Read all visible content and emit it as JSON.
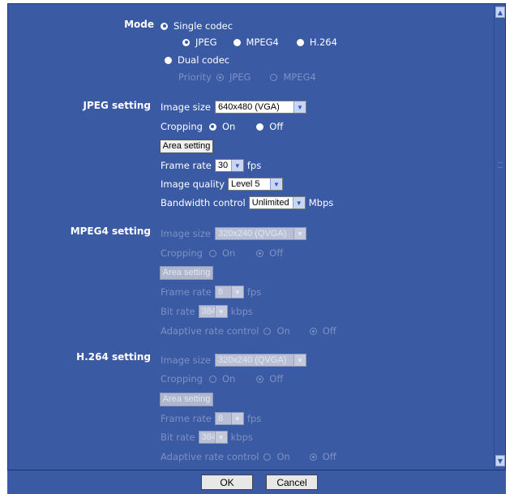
{
  "mode": {
    "label": "Mode",
    "single_codec": "Single codec",
    "jpeg": "JPEG",
    "mpeg4": "MPEG4",
    "h264": "H.264",
    "dual_codec": "Dual codec",
    "priority": "Priority",
    "priority_jpeg": "JPEG",
    "priority_mpeg4": "MPEG4"
  },
  "jpeg": {
    "label": "JPEG setting",
    "image_size_label": "Image size",
    "image_size_value": "640x480 (VGA)",
    "cropping_label": "Cropping",
    "on": "On",
    "off": "Off",
    "area_setting": "Area setting",
    "frame_rate_label": "Frame rate",
    "frame_rate_value": "30",
    "fps": "fps",
    "image_quality_label": "Image quality",
    "image_quality_value": "Level 5",
    "bandwidth_label": "Bandwidth control",
    "bandwidth_value": "Unlimited",
    "mbps": "Mbps"
  },
  "mpeg4": {
    "label": "MPEG4 setting",
    "image_size_label": "Image size",
    "image_size_value": "320x240 (QVGA)",
    "cropping_label": "Cropping",
    "on": "On",
    "off": "Off",
    "area_setting": "Area setting",
    "frame_rate_label": "Frame rate",
    "frame_rate_value": "8",
    "fps": "fps",
    "bit_rate_label": "Bit rate",
    "bit_rate_value": "384",
    "kbps": "kbps",
    "adaptive_label": "Adaptive rate control",
    "adaptive_on": "On",
    "adaptive_off": "Off"
  },
  "h264": {
    "label": "H.264 setting",
    "image_size_label": "Image size",
    "image_size_value": "320x240 (QVGA)",
    "cropping_label": "Cropping",
    "on": "On",
    "off": "Off",
    "area_setting": "Area setting",
    "frame_rate_label": "Frame rate",
    "frame_rate_value": "8",
    "fps": "fps",
    "bit_rate_label": "Bit rate",
    "bit_rate_value": "384",
    "kbps": "kbps",
    "adaptive_label": "Adaptive rate control",
    "adaptive_on": "On",
    "adaptive_off": "Off"
  },
  "footer": {
    "ok": "OK",
    "cancel": "Cancel"
  },
  "icons": {
    "scroll_up": "chevron-up-icon",
    "scroll_down": "chevron-down-icon",
    "select_arrow": "chevron-down-icon"
  },
  "colors": {
    "panel": "#3a5aa4",
    "disabled_text": "#7f91c2"
  }
}
